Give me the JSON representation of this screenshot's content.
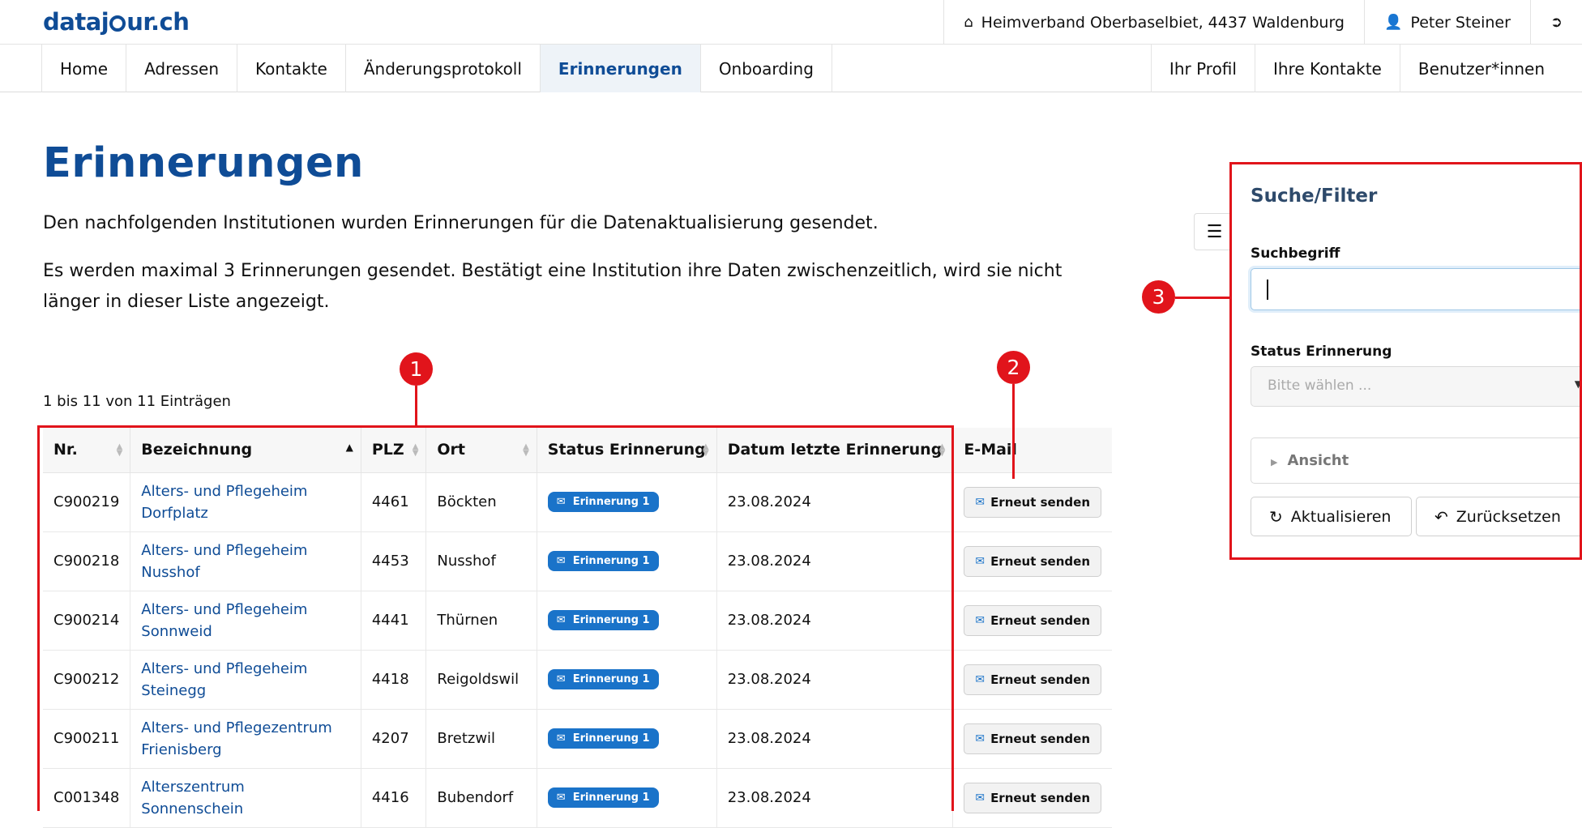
{
  "app": {
    "logo_pre": "dataj",
    "logo_post": "ur.ch"
  },
  "topbar": {
    "organisation": "Heimverband Oberbaselbiet, 4437 Waldenburg",
    "user": "Peter Steiner"
  },
  "nav": {
    "left": [
      "Home",
      "Adressen",
      "Kontakte",
      "Änderungsprotokoll",
      "Erinnerungen",
      "Onboarding"
    ],
    "right": [
      "Ihr Profil",
      "Ihre Kontakte",
      "Benutzer*innen"
    ]
  },
  "page": {
    "title": "Erinnerungen",
    "intro1": "Den nachfolgenden Institutionen wurden Erinnerungen für die Datenaktualisierung gesendet.",
    "intro2": "Es werden maximal 3 Erinnerungen gesendet. Bestätigt eine Institution ihre Daten zwischenzeitlich, wird sie nicht länger in dieser Liste angezeigt.",
    "count": "1 bis 11 von 11 Einträgen"
  },
  "table": {
    "headers": [
      "Nr.",
      "Bezeichnung",
      "PLZ",
      "Ort",
      "Status Erinnerung",
      "Datum letzte Erinnerung",
      "E-Mail"
    ],
    "rows": [
      {
        "nr": "C900219",
        "name1": "Alters- und Pflegeheim",
        "name2": "Dorfplatz",
        "plz": "4461",
        "ort": "Böckten",
        "status": "Erinnerung 1",
        "datum": "23.08.2024",
        "action": "Erneut senden"
      },
      {
        "nr": "C900218",
        "name1": "Alters- und Pflegeheim",
        "name2": "Nusshof",
        "plz": "4453",
        "ort": "Nusshof",
        "status": "Erinnerung 1",
        "datum": "23.08.2024",
        "action": "Erneut senden"
      },
      {
        "nr": "C900214",
        "name1": "Alters- und Pflegeheim",
        "name2": "Sonnweid",
        "plz": "4441",
        "ort": "Thürnen",
        "status": "Erinnerung 1",
        "datum": "23.08.2024",
        "action": "Erneut senden"
      },
      {
        "nr": "C900212",
        "name1": "Alters- und Pflegeheim",
        "name2": "Steinegg",
        "plz": "4418",
        "ort": "Reigoldswil",
        "status": "Erinnerung 1",
        "datum": "23.08.2024",
        "action": "Erneut senden"
      },
      {
        "nr": "C900211",
        "name1": "Alters- und Pflegezentrum",
        "name2": "Frienisberg",
        "plz": "4207",
        "ort": "Bretzwil",
        "status": "Erinnerung 1",
        "datum": "23.08.2024",
        "action": "Erneut senden"
      },
      {
        "nr": "C001348",
        "name1": "Alterszentrum Sonnenschein",
        "name2": "",
        "plz": "4416",
        "ort": "Bubendorf",
        "status": "Erinnerung 1",
        "datum": "23.08.2024",
        "action": "Erneut senden"
      }
    ]
  },
  "filter": {
    "title": "Suche/Filter",
    "search_label": "Suchbegriff",
    "status_label": "Status Erinnerung",
    "status_placeholder": "Bitte wählen ...",
    "view_label": "Ansicht",
    "refresh": "Aktualisieren",
    "reset": "Zurücksetzen"
  },
  "markers": [
    "1",
    "2",
    "3"
  ],
  "colors": {
    "brand": "#0f4c96",
    "badge": "#1a73c9",
    "annotation": "#e1141b"
  }
}
